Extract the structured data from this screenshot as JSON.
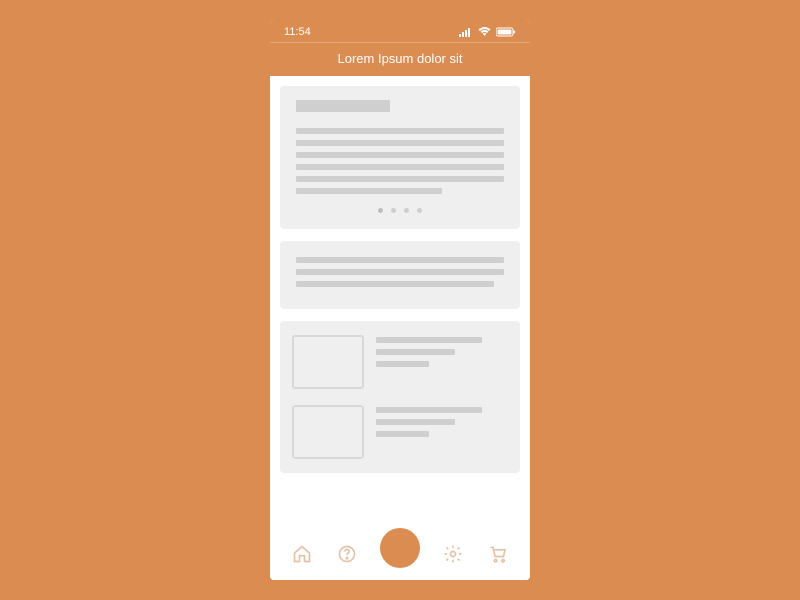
{
  "statusBar": {
    "time": "11:54"
  },
  "header": {
    "title": "Lorem Ipsum dolor sit"
  },
  "colors": {
    "accent": "#db8c51",
    "placeholder": "#cfcfcf",
    "cardBg": "#efefef"
  },
  "carousel": {
    "dotCount": 4,
    "activeIndex": 0
  },
  "tabs": [
    {
      "icon": "home-icon"
    },
    {
      "icon": "help-icon"
    },
    {
      "icon": "center-action"
    },
    {
      "icon": "settings-icon"
    },
    {
      "icon": "cart-icon"
    }
  ]
}
